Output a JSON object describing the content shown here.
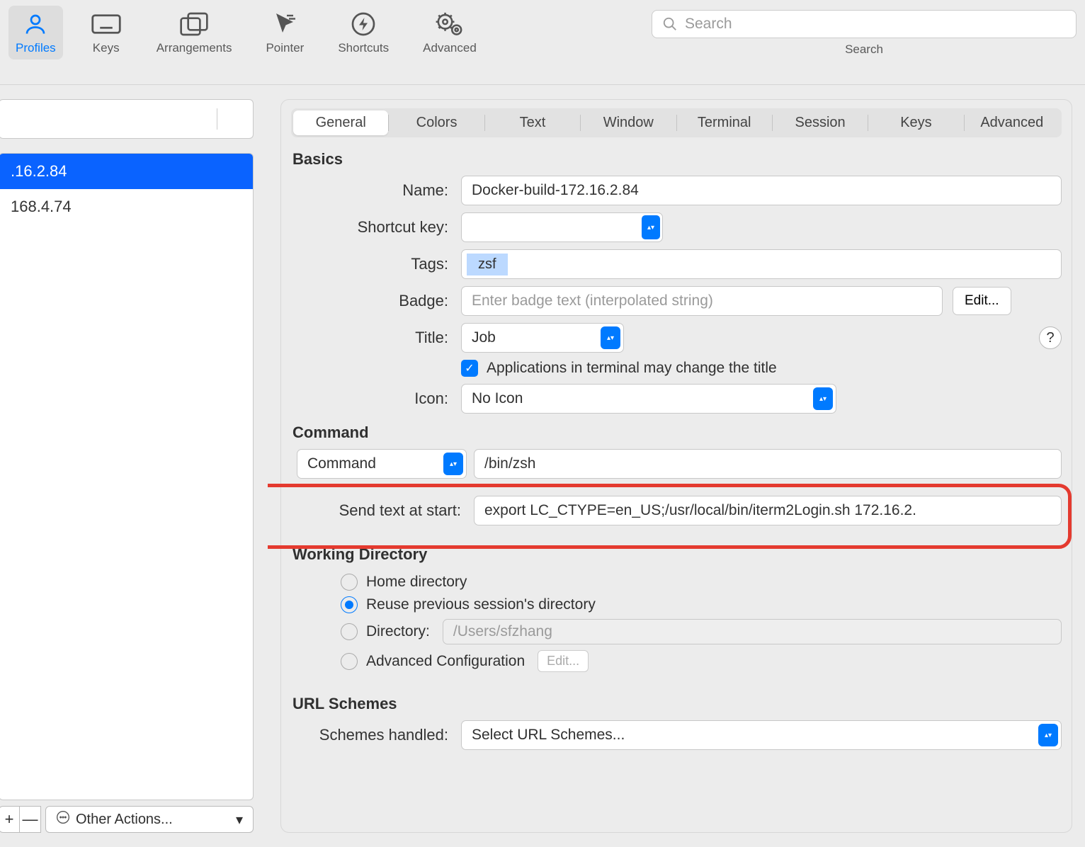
{
  "toolbar": {
    "items": [
      {
        "label": "Profiles",
        "icon": "person-icon",
        "active": true
      },
      {
        "label": "Keys",
        "icon": "keyboard-icon"
      },
      {
        "label": "Arrangements",
        "icon": "windows-icon"
      },
      {
        "label": "Pointer",
        "icon": "cursor-icon"
      },
      {
        "label": "Shortcuts",
        "icon": "bolt-circle-icon"
      },
      {
        "label": "Advanced",
        "icon": "gears-icon"
      }
    ],
    "search_placeholder": "Search",
    "search_label": "Search"
  },
  "sidebar": {
    "profiles": [
      {
        "label": ".16.2.84",
        "selected": true
      },
      {
        "label": "168.4.74",
        "selected": false
      }
    ],
    "add": "+",
    "remove": "—",
    "other_actions": "Other Actions..."
  },
  "tabs": [
    "General",
    "Colors",
    "Text",
    "Window",
    "Terminal",
    "Session",
    "Keys",
    "Advanced"
  ],
  "active_tab": "General",
  "basics": {
    "heading": "Basics",
    "name_label": "Name:",
    "name_value": "Docker-build-172.16.2.84",
    "shortcut_label": "Shortcut key:",
    "tags_label": "Tags:",
    "tag_value": "zsf",
    "badge_label": "Badge:",
    "badge_placeholder": "Enter badge text (interpolated string)",
    "edit_label": "Edit...",
    "title_label": "Title:",
    "title_value": "Job",
    "title_checkbox": "Applications in terminal may change the title",
    "icon_label": "Icon:",
    "icon_value": "No Icon"
  },
  "command": {
    "heading": "Command",
    "command_label": "Command",
    "command_value": "/bin/zsh",
    "send_label": "Send text at start:",
    "send_value": "export LC_CTYPE=en_US;/usr/local/bin/iterm2Login.sh 172.16.2."
  },
  "workdir": {
    "heading": "Working Directory",
    "home": "Home directory",
    "reuse": "Reuse previous session's directory",
    "directory_label": "Directory:",
    "directory_value": "/Users/sfzhang",
    "advanced_label": "Advanced Configuration",
    "edit_label": "Edit..."
  },
  "urlschemes": {
    "heading": "URL Schemes",
    "schemes_label": "Schemes handled:",
    "schemes_value": "Select URL Schemes..."
  }
}
